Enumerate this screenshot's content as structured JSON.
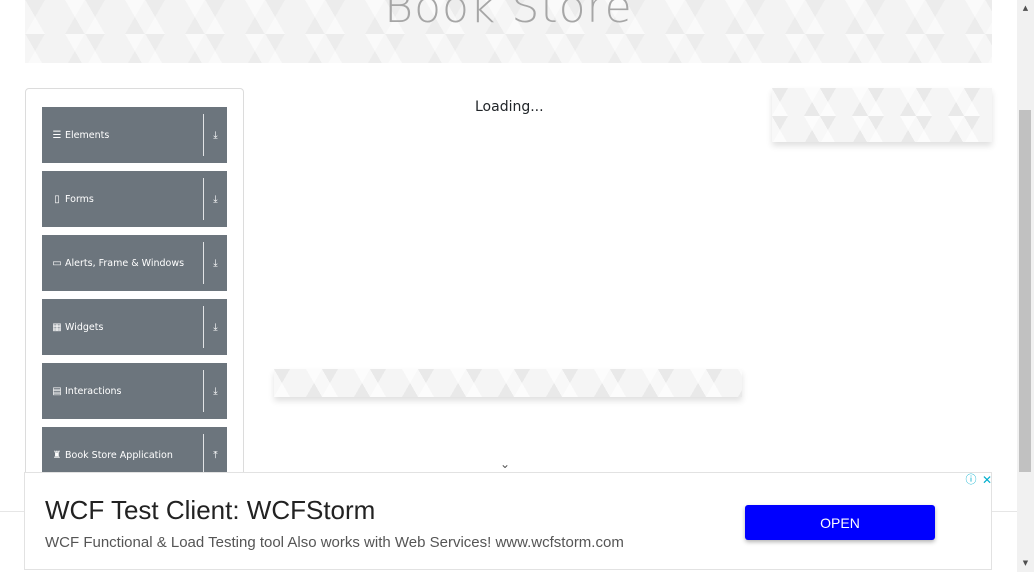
{
  "header": {
    "title": "Book Store"
  },
  "sidebar": {
    "groups": [
      {
        "label": "Elements",
        "icon": "hamburger-icon",
        "glyph": "☰",
        "arrow": "⤓"
      },
      {
        "label": "Forms",
        "icon": "document-icon",
        "glyph": "▯",
        "arrow": "⤓"
      },
      {
        "label": "Alerts, Frame & Windows",
        "icon": "window-icon",
        "glyph": "▭",
        "arrow": "⤓"
      },
      {
        "label": "Widgets",
        "icon": "grid-icon",
        "glyph": "▦",
        "arrow": "⤓"
      },
      {
        "label": "Interactions",
        "icon": "list-icon",
        "glyph": "▤",
        "arrow": "⤓"
      },
      {
        "label": "Book Store Application",
        "icon": "books-icon",
        "glyph": "♜",
        "arrow": "⤒"
      }
    ]
  },
  "main": {
    "loading_text": "Loading..."
  },
  "more_indicator": {
    "glyph": "⌄"
  },
  "ad": {
    "title": "WCF Test Client: WCFStorm",
    "description": "WCF Functional & Load Testing tool Also works with Web Services! www.wcfstorm.com",
    "cta": "OPEN",
    "info_glyph": "ⓘ",
    "close_glyph": "✕",
    "cta_color": "#0000ff"
  },
  "scrollbar": {
    "up_glyph": "▲",
    "down_glyph": "▼"
  }
}
